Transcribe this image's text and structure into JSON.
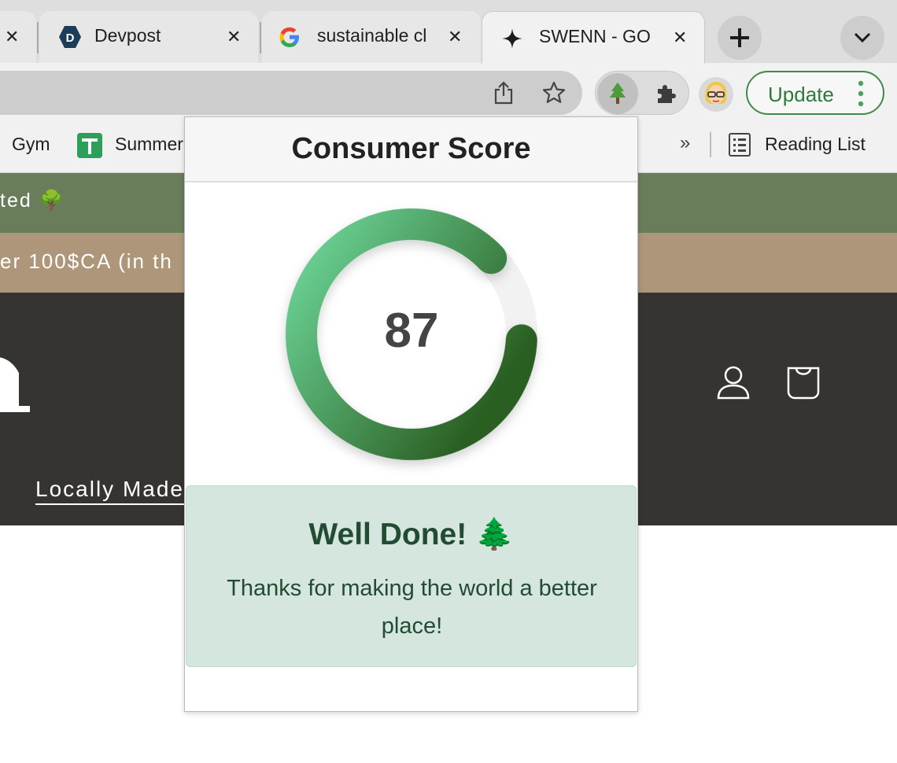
{
  "browser": {
    "tabs": [
      {
        "title": "",
        "icon": "unknown-favicon"
      },
      {
        "title": "Devpost",
        "icon": "devpost-icon"
      },
      {
        "title": "sustainable cl",
        "icon": "google-icon"
      },
      {
        "title": "SWENN - GO",
        "icon": "sparkle-icon"
      }
    ],
    "update_label": "Update",
    "bookmarks": [
      {
        "label": "Gym"
      },
      {
        "label": "Summer",
        "icon": "sheets-icon"
      }
    ],
    "more_bookmarks": "»",
    "reading_list_label": "Reading List"
  },
  "page": {
    "banner_green_text": "ted 🌳",
    "banner_tan_text": "er 100$CA (in th",
    "nav_link": "Locally Made",
    "colors": {
      "banner_green": "#697d5b",
      "banner_tan": "#ad9679",
      "header_dark": "#363431"
    }
  },
  "popup": {
    "title": "Consumer Score",
    "score": "87",
    "score_value": 87,
    "score_max": 100,
    "alert_title": "Well Done! 🌲",
    "alert_body": "Thanks for making the world a better place!",
    "colors": {
      "gauge_start": "#6fd89b",
      "gauge_end": "#2a5e22",
      "alert_bg": "#d4e6de",
      "alert_text": "#234b34"
    }
  }
}
